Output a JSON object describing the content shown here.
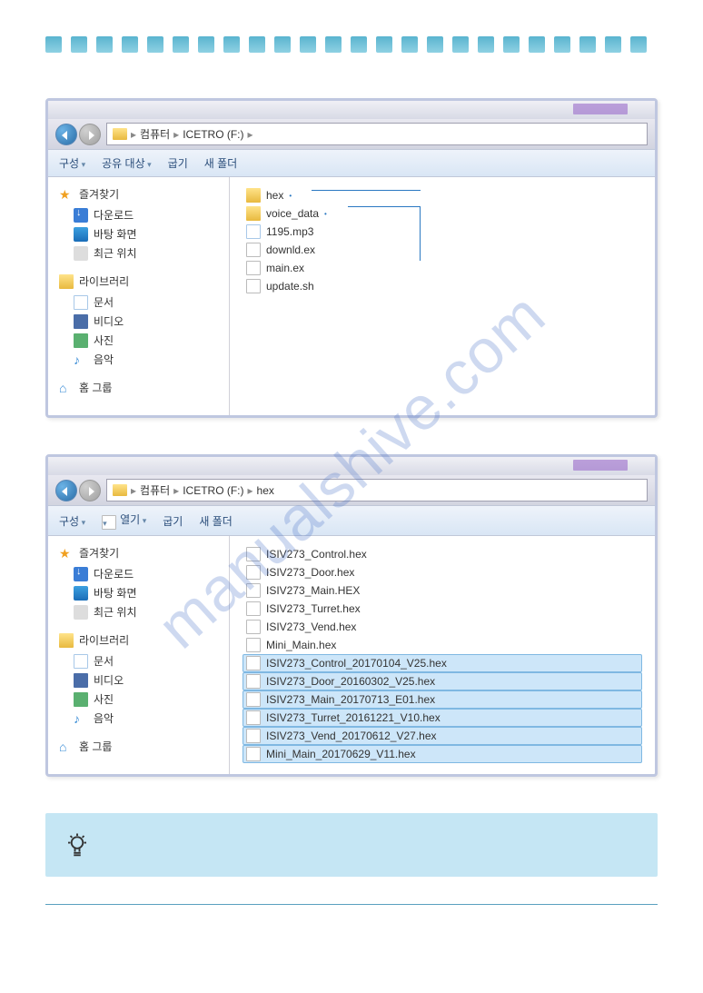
{
  "watermark": "manualshive.com",
  "explorer1": {
    "breadcrumb": [
      "컴퓨터",
      "ICETRO (F:)"
    ],
    "toolbar": [
      "구성",
      "공유 대상",
      "굽기",
      "새 폴더"
    ],
    "sidebar": {
      "favorites": {
        "label": "즐겨찾기",
        "items": [
          "다운로드",
          "바탕 화면",
          "최근 위치"
        ]
      },
      "libraries": {
        "label": "라이브러리",
        "items": [
          "문서",
          "비디오",
          "사진",
          "음악"
        ]
      },
      "homegroup": {
        "label": "홈 그룹"
      }
    },
    "files": [
      {
        "name": "hex",
        "type": "folder"
      },
      {
        "name": "voice_data",
        "type": "folder"
      },
      {
        "name": "1195.mp3",
        "type": "mp3"
      },
      {
        "name": "downld.ex",
        "type": "file"
      },
      {
        "name": "main.ex",
        "type": "file"
      },
      {
        "name": "update.sh",
        "type": "file"
      }
    ]
  },
  "explorer2": {
    "breadcrumb": [
      "컴퓨터",
      "ICETRO (F:)",
      "hex"
    ],
    "toolbar": [
      "구성",
      "열기",
      "굽기",
      "새 폴더"
    ],
    "sidebar": {
      "favorites": {
        "label": "즐겨찾기",
        "items": [
          "다운로드",
          "바탕 화면",
          "최근 위치"
        ]
      },
      "libraries": {
        "label": "라이브러리",
        "items": [
          "문서",
          "비디오",
          "사진",
          "음악"
        ]
      },
      "homegroup": {
        "label": "홈 그룹"
      }
    },
    "files": [
      {
        "name": "ISIV273_Control.hex",
        "sel": false
      },
      {
        "name": "ISIV273_Door.hex",
        "sel": false
      },
      {
        "name": "ISIV273_Main.HEX",
        "sel": false
      },
      {
        "name": "ISIV273_Turret.hex",
        "sel": false
      },
      {
        "name": "ISIV273_Vend.hex",
        "sel": false
      },
      {
        "name": "Mini_Main.hex",
        "sel": false
      },
      {
        "name": "ISIV273_Control_20170104_V25.hex",
        "sel": true
      },
      {
        "name": "ISIV273_Door_20160302_V25.hex",
        "sel": true
      },
      {
        "name": "ISIV273_Main_20170713_E01.hex",
        "sel": true
      },
      {
        "name": "ISIV273_Turret_20161221_V10.hex",
        "sel": true
      },
      {
        "name": "ISIV273_Vend_20170612_V27.hex",
        "sel": true
      },
      {
        "name": "Mini_Main_20170629_V11.hex",
        "sel": true
      }
    ]
  }
}
